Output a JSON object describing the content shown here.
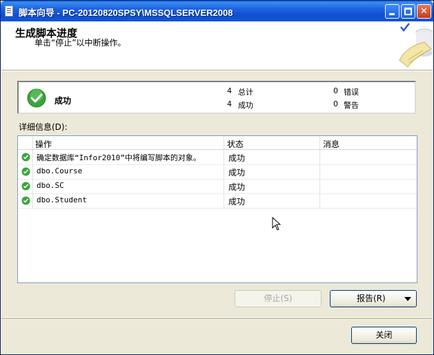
{
  "window": {
    "title": "脚本向导 - PC-20120820SPSY\\MSSQLSERVER2008",
    "icon": "document-icon"
  },
  "header": {
    "title": "生成脚本进度",
    "subtitle": "单击“停止”以中断操作。"
  },
  "summary": {
    "status_label": "成功",
    "status_icon": "success-check-icon",
    "total_count": "4",
    "total_label": "总计",
    "success_count": "4",
    "success_label": "成功",
    "error_count": "0",
    "error_label": "错误",
    "warning_count": "0",
    "warning_label": "警告"
  },
  "details": {
    "label": "详细信息(D):",
    "columns": [
      "操作",
      "状态",
      "消息"
    ],
    "rows": [
      {
        "operation": "确定数据库“Infor2010”中将编写脚本的对象。",
        "status": "成功",
        "message": ""
      },
      {
        "operation": "dbo.Course",
        "status": "成功",
        "message": ""
      },
      {
        "operation": "dbo.SC",
        "status": "成功",
        "message": ""
      },
      {
        "operation": "dbo.Student",
        "status": "成功",
        "message": ""
      }
    ]
  },
  "buttons": {
    "stop": "停止(S)",
    "report": "报告(R)",
    "close": "关闭"
  },
  "colors": {
    "title_bar": "#0a5fd6",
    "success_green": "#3aa53a",
    "dialog_bg": "#ece9d8"
  }
}
